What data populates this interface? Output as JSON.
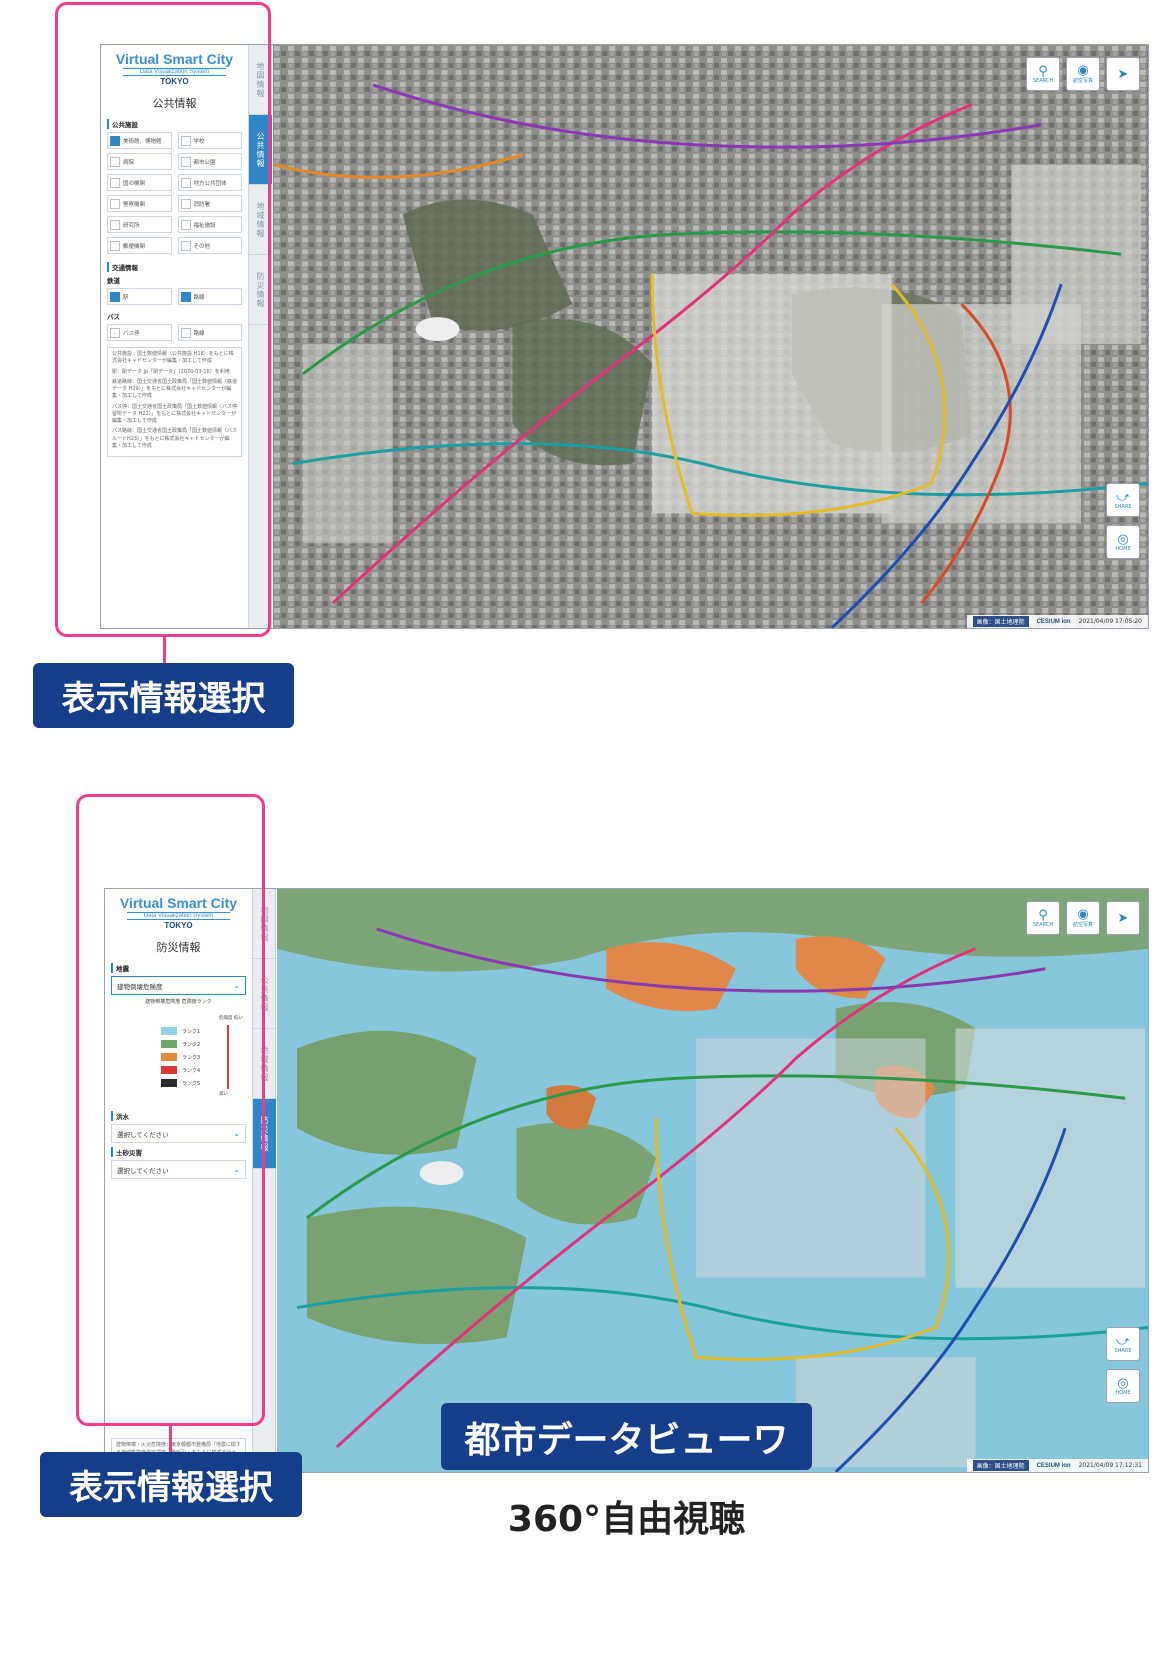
{
  "screens": [
    {
      "logo": {
        "line1": "Virtual Smart City",
        "line2": "Data Visualization System",
        "line3": "TOKYO"
      },
      "tabs": [
        "地図情報",
        "公共情報",
        "地域情報",
        "防災情報"
      ],
      "panel_title": "公共情報",
      "sections": [
        {
          "title": "公共施設",
          "items": [
            {
              "label": "美術館、博物館",
              "checked": true
            },
            {
              "label": "学校",
              "checked": false
            },
            {
              "label": "病院",
              "checked": false
            },
            {
              "label": "都市公園",
              "checked": false
            },
            {
              "label": "国の機関",
              "checked": false
            },
            {
              "label": "地方公共団体",
              "checked": false
            },
            {
              "label": "警察機関",
              "checked": false
            },
            {
              "label": "消防署",
              "checked": false
            },
            {
              "label": "研究所",
              "checked": false
            },
            {
              "label": "福祉施設",
              "checked": false
            },
            {
              "label": "郵便機関",
              "checked": false
            },
            {
              "label": "その他",
              "checked": false
            }
          ]
        },
        {
          "title": "交通情報",
          "subtitle": "鉄道",
          "items": [
            {
              "label": "駅",
              "checked": true
            },
            {
              "label": "路線",
              "checked": true
            }
          ]
        },
        {
          "subtitle": "バス",
          "items": [
            {
              "label": "バス停",
              "checked": false
            },
            {
              "label": "路線",
              "checked": false
            }
          ]
        }
      ],
      "attribution": [
        "公共施設：国土数値情報（公共施設 H18）をもとに株式会社キャドセンターが編集・加工して作成",
        "駅：駅データ.jp「駅データ」（2020-03-16）を利用",
        "鉄道路線：国土交通省国土政策局「国土数値情報（鉄道データ H29）」をもとに株式会社キャドセンターが編集・加工して作成",
        "バス停：国土交通省国土政策局「国土数値情報（バス停留所データ H22）」をもとに株式会社キャドセンターが編集・加工して作成",
        "バス路線：国土交通省国土政策局「国土数値情報（バスルートH23）」をもとに株式会社キャドセンターが編集・加工して作成"
      ],
      "buttons": {
        "search": "SEARCH",
        "photo": "航空写真",
        "share": "SHARE",
        "home": "HOME"
      },
      "credit": {
        "gsi": "画像：国土地理院",
        "cesium": "CESIUM ion",
        "timestamp": "2021/04/09 17:05:20"
      }
    },
    {
      "logo": {
        "line1": "Virtual Smart City",
        "line2": "Data Visualization System",
        "line3": "TOKYO"
      },
      "tabs": [
        "地図情報",
        "公共情報",
        "地域情報",
        "防災情報"
      ],
      "panel_title": "防災情報",
      "hazards": [
        {
          "title": "地震",
          "selected": "建物倒壊危険度"
        },
        {
          "title": "洪水",
          "selected": "選択してください"
        },
        {
          "title": "土砂災害",
          "selected": "選択してください"
        }
      ],
      "legend": {
        "title": "建物倒壊危険度 危険度ランク",
        "top": "危険度 低い",
        "bottom": "高い",
        "ranks": [
          {
            "label": "ランク1",
            "color": "#8fd3e6"
          },
          {
            "label": "ランク2",
            "color": "#6aa86a"
          },
          {
            "label": "ランク3",
            "color": "#e08a3c"
          },
          {
            "label": "ランク4",
            "color": "#d83a3a"
          },
          {
            "label": "ランク5",
            "color": "#2b2b2b"
          }
        ]
      },
      "attribution": "建物倒壊・火災危険度：東京都都市整備局「地震に関する地域危険度測定調査（第8回）」をもとに株式会社キャドセンターが編集・加工して作成",
      "buttons": {
        "search": "SEARCH",
        "photo": "航空写真",
        "share": "SHARE",
        "home": "HOME"
      },
      "credit": {
        "gsi": "画像：国土地理院",
        "cesium": "CESIUM ion",
        "timestamp": "2021/04/09 17:12:31"
      }
    }
  ],
  "labels": {
    "select1": "表示情報選択",
    "select2": "表示情報選択",
    "viewer": "都市データビューワ",
    "caption": "360°自由視聴"
  },
  "colors": {
    "frame": "#ef3c8b",
    "label_bg": "#143d8a",
    "accent": "#2f86c9"
  }
}
